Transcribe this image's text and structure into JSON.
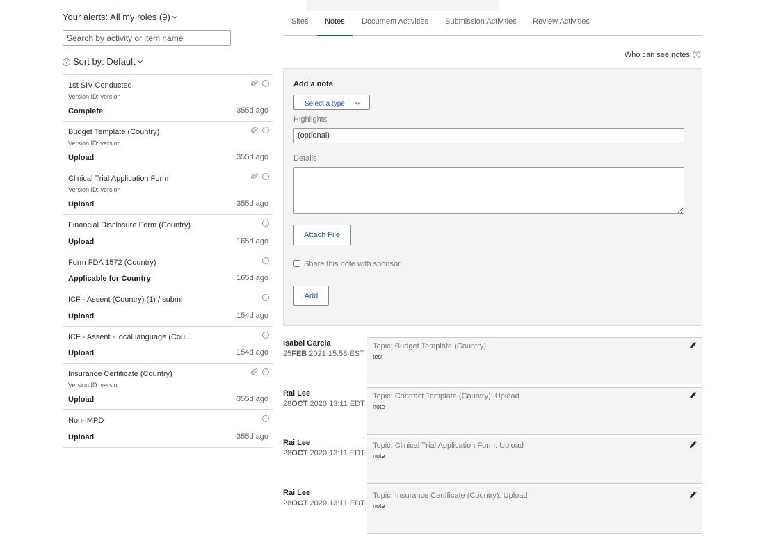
{
  "sidebar": {
    "alerts_label": "Your alerts: All my roles (9)",
    "search_placeholder": "Search by activity or item name",
    "sort_label": "Sort by: Default",
    "items": [
      {
        "title": "1st SIV Conducted",
        "version": "Version ID: version",
        "status": "Complete",
        "ago": "355d ago",
        "has_attachment": true
      },
      {
        "title": "Budget Template (Country)",
        "version": "Version ID: version",
        "status": "Upload",
        "ago": "355d ago",
        "has_attachment": true
      },
      {
        "title": "Clinical Trial Application Form",
        "version": "Version ID: version",
        "status": "Upload",
        "ago": "355d ago",
        "has_attachment": true
      },
      {
        "title": "Financial Disclosure Form (Country)",
        "version": "",
        "status": "Upload",
        "ago": "165d ago",
        "has_attachment": false
      },
      {
        "title": "Form FDA 1572 (Country)",
        "version": "",
        "status": "Applicable for Country",
        "ago": "165d ago",
        "has_attachment": false
      },
      {
        "title": "ICF - Assent (Country) (1) / submi",
        "version": "",
        "status": "Upload",
        "ago": "154d ago",
        "has_attachment": false
      },
      {
        "title": "ICF - Assent - local language (Coun…",
        "version": "",
        "status": "Upload",
        "ago": "154d ago",
        "has_attachment": false
      },
      {
        "title": "Insurance Certificate (Country)",
        "version": "Version ID: version",
        "status": "Upload",
        "ago": "355d ago",
        "has_attachment": true
      },
      {
        "title": "Non-IMPD",
        "version": "",
        "status": "Upload",
        "ago": "355d ago",
        "has_attachment": false
      }
    ]
  },
  "tabs": [
    {
      "label": "Sites",
      "active": false
    },
    {
      "label": "Notes",
      "active": true
    },
    {
      "label": "Document Activities",
      "active": false
    },
    {
      "label": "Submission Activities",
      "active": false
    },
    {
      "label": "Review Activities",
      "active": false
    }
  ],
  "who_can_see": "Who can see notes",
  "add_note": {
    "title": "Add a note",
    "select_type": "Select a type",
    "highlights_label": "Highlights",
    "highlights_placeholder": "(optional)",
    "details_label": "Details",
    "attach_label": "Attach File",
    "share_label": "Share this note with sponsor",
    "add_label": "Add"
  },
  "notes": [
    {
      "author": "Isabel Garcia",
      "day": "25",
      "month": "FEB",
      "rest": " 2021 15:58 EST",
      "topic": "Topic: Budget Template (Country)",
      "text": "test"
    },
    {
      "author": "Rai Lee",
      "day": "28",
      "month": "OCT",
      "rest": " 2020 13:11 EDT",
      "topic": "Topic: Contract Template (Country): Upload",
      "text": "note"
    },
    {
      "author": "Rai Lee",
      "day": "28",
      "month": "OCT",
      "rest": " 2020 13:11 EDT",
      "topic": "Topic: Clinical Trial Application Form: Upload",
      "text": "note"
    },
    {
      "author": "Rai Lee",
      "day": "28",
      "month": "OCT",
      "rest": " 2020 13:11 EDT",
      "topic": "Topic: Insurance Certificate (Country): Upload",
      "text": "note"
    }
  ],
  "colors": {
    "accent": "#1f5aa6",
    "panel": "#f4f4f4"
  }
}
